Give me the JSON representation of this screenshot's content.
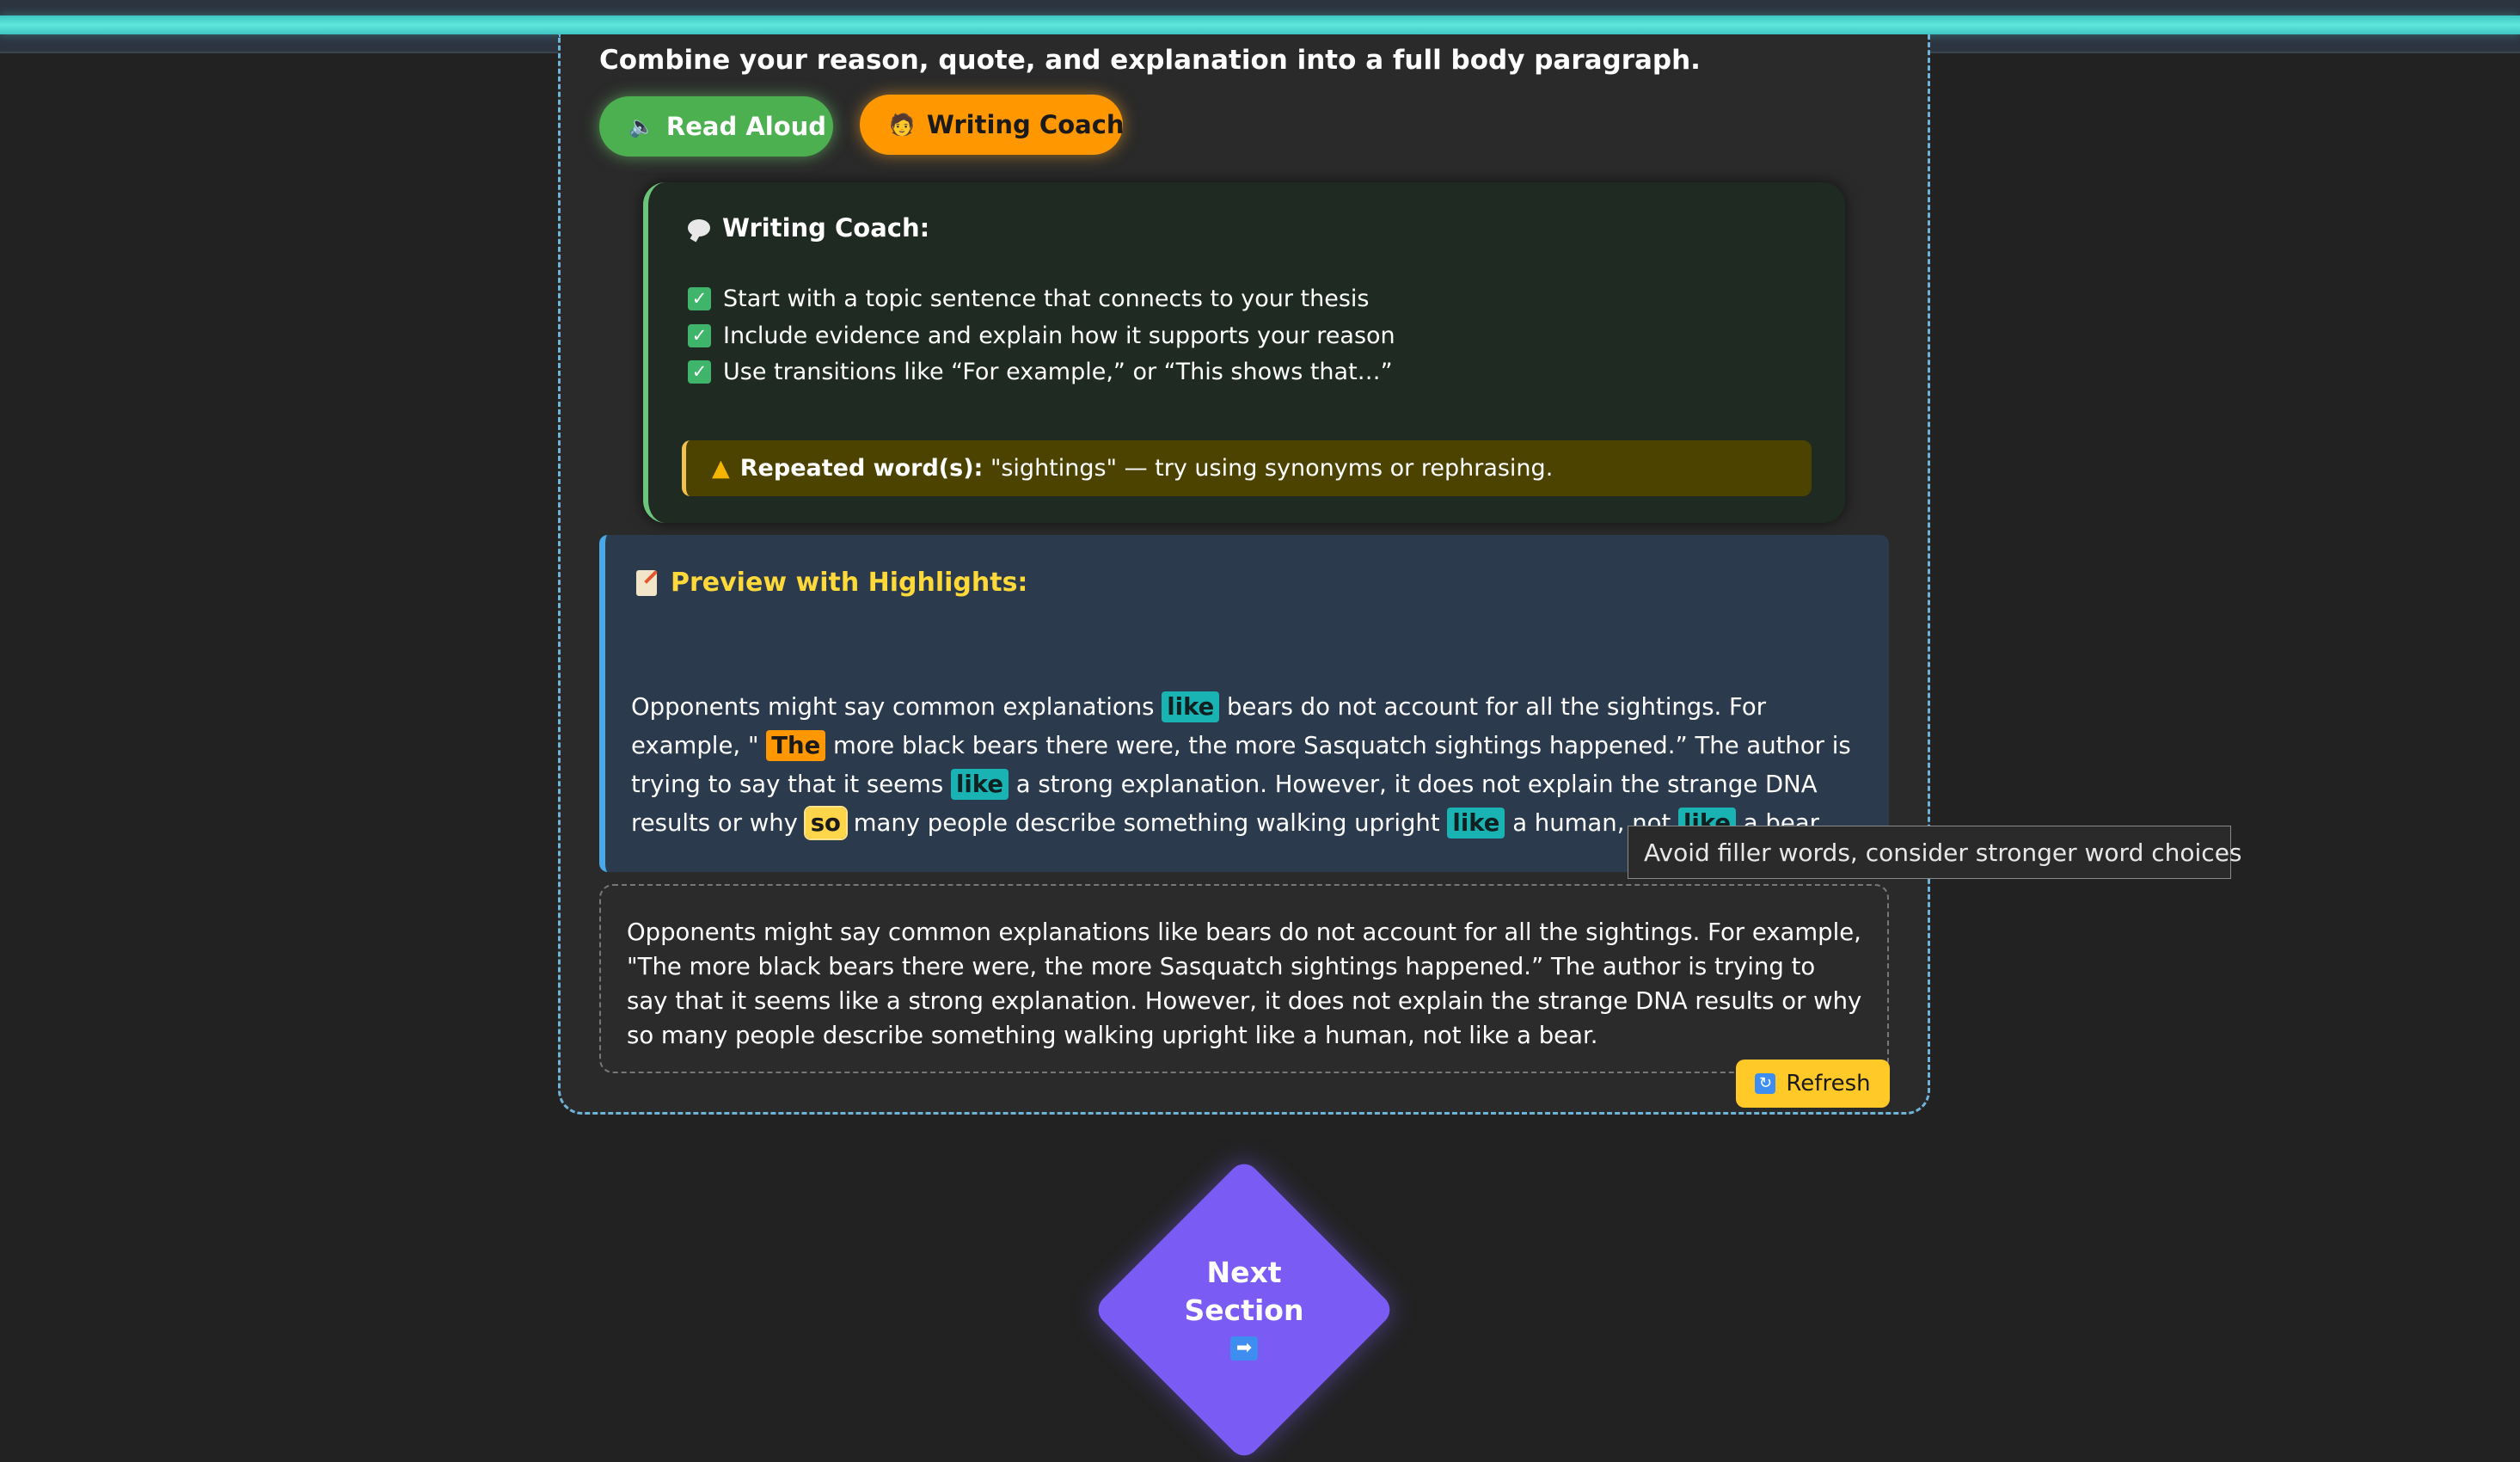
{
  "instruction": "Combine your reason, quote, and explanation into a full body paragraph.",
  "toolbar": {
    "read_aloud_label": "Read Aloud",
    "writing_coach_label": "Writing Coach"
  },
  "coach": {
    "title": "Writing Coach:",
    "checklist": [
      "Start with a topic sentence that connects to your thesis",
      "Include evidence and explain how it supports your reason",
      "Use transitions like “For example,” or “This shows that…”"
    ],
    "warning_label": "Repeated word(s):",
    "warning_text": " \"sightings\" — try using synonyms or rephrasing."
  },
  "preview": {
    "title": "Preview with Highlights:",
    "segments": [
      {
        "text": "Opponents might say common explanations ",
        "hl": null
      },
      {
        "text": "like",
        "hl": "like"
      },
      {
        "text": " bears do not account for all the sightings. For example, \" ",
        "hl": null
      },
      {
        "text": "The",
        "hl": "the"
      },
      {
        "text": " more black bears there were, the more Sasquatch sightings happened.” The author is trying to say that it seems ",
        "hl": null
      },
      {
        "text": "like",
        "hl": "like"
      },
      {
        "text": " a strong explanation. However, it does not explain the strange DNA results or why ",
        "hl": null
      },
      {
        "text": "so",
        "hl": "so"
      },
      {
        "text": " many people describe something walking upright ",
        "hl": null
      },
      {
        "text": "like",
        "hl": "like"
      },
      {
        "text": " a human, not ",
        "hl": null
      },
      {
        "text": "like",
        "hl": "like"
      },
      {
        "text": " a bear.",
        "hl": null
      }
    ]
  },
  "tooltip": "Avoid filler words, consider stronger word choices",
  "paragraph_input": {
    "value": "Opponents might say common explanations like bears do not account for all the sightings. For example, \"The more black bears there were, the more Sasquatch sightings happened.” The author is trying to say that it seems like a strong explanation. However, it does not explain the strange DNA results or why so many people describe something walking upright like a human, not like a bear."
  },
  "refresh_label": "Refresh",
  "next_section": {
    "label_line1": "Next",
    "label_line2": "Section",
    "arrow": "➡"
  },
  "colors": {
    "accent_teal": "#5fe6dc",
    "read_aloud": "#4caf50",
    "writing_coach": "#ff9800",
    "preview_title": "#ffd83a",
    "next_section": "#7a5cf5",
    "refresh": "#ffc928"
  },
  "icons": {
    "read_aloud": "speaker-icon",
    "writing_coach": "coach-icon",
    "coach_title": "speech-bubble-icon",
    "check": "checkbox-checked-icon",
    "warning": "warning-icon",
    "preview": "memo-icon",
    "refresh": "refresh-icon",
    "next": "arrow-right-icon"
  }
}
